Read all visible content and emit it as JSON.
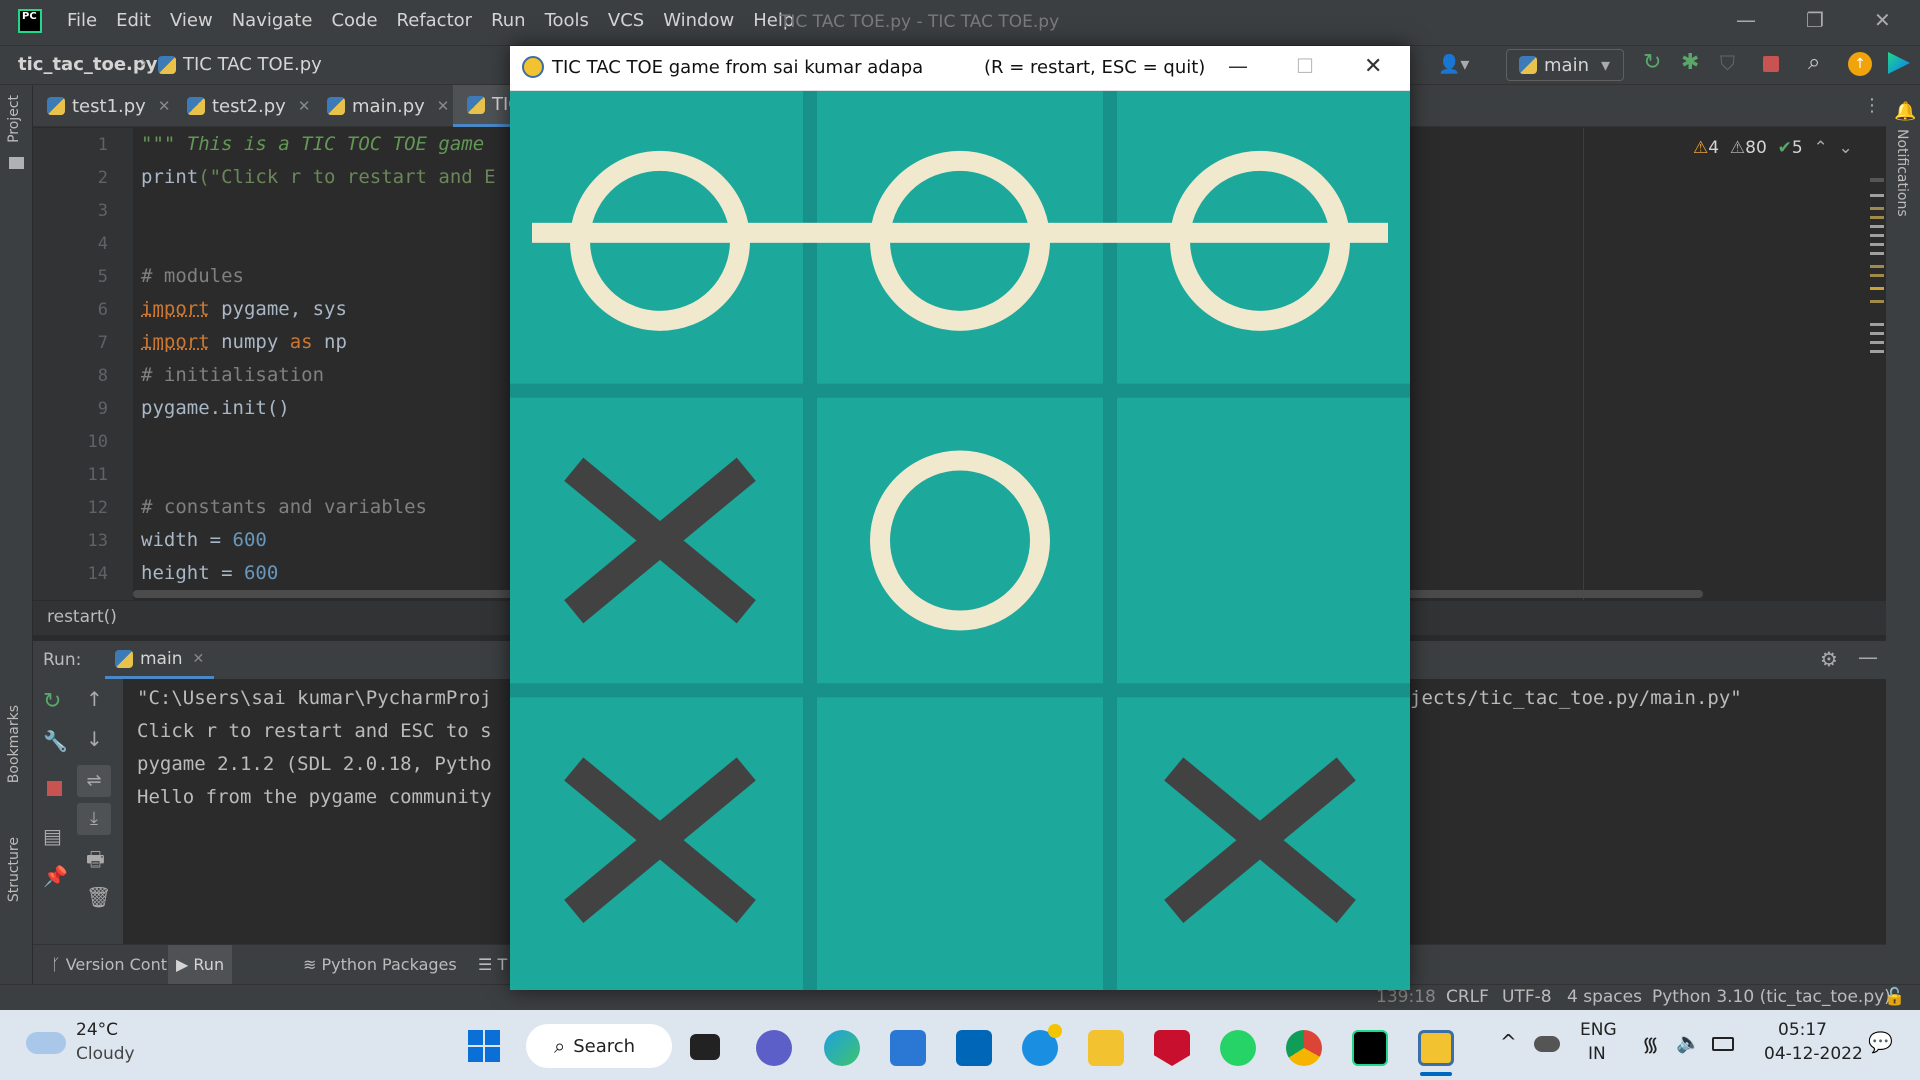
{
  "window": {
    "file_title": "TIC TAC TOE.py - TIC TAC TOE.py",
    "menu": [
      "File",
      "Edit",
      "View",
      "Navigate",
      "Code",
      "Refactor",
      "Run",
      "Tools",
      "VCS",
      "Window",
      "Help"
    ],
    "controls": {
      "minimize": "—",
      "restore": "❐",
      "close": "✕"
    }
  },
  "navbar": {
    "project": "tic_tac_toe.py",
    "file": "TIC TAC TOE.py",
    "run_config": "main"
  },
  "side": {
    "project_label": "Project",
    "bookmarks_label": "Bookmarks",
    "structure_label": "Structure",
    "notifications_label": "Notifications"
  },
  "tabs": [
    {
      "label": "test1.py"
    },
    {
      "label": "test2.py"
    },
    {
      "label": "main.py"
    },
    {
      "label": "TIC"
    }
  ],
  "inspections": {
    "warnings": "4",
    "weak_warnings": "80",
    "typos": "5"
  },
  "editor": {
    "line_numbers": [
      "1",
      "2",
      "3",
      "4",
      "5",
      "6",
      "7",
      "8",
      "9",
      "10",
      "11",
      "12",
      "13",
      "14"
    ],
    "line1": "\"\"\" This is a TIC TOC TOE game",
    "line2_fn": "print",
    "line2_str": "(\"Click r to restart and E",
    "line5": "# modules",
    "line6_kw": "import",
    "line6_rest": " pygame, sys",
    "line7_kw": "import",
    "line7_mid": " numpy ",
    "line7_as": "as",
    "line7_end": " np",
    "line8": "# initialisation",
    "line9": "pygame.init()",
    "line12": "# constants and variables",
    "line13_var": "width = ",
    "line13_num": "600",
    "line14_var": "height = ",
    "line14_num": "600"
  },
  "breadcrumb": "restart()",
  "run": {
    "label": "Run:",
    "tab": "main",
    "console": [
      "\"C:\\Users\\sai kumar\\PycharmProj",
      "Click r to restart and ESC to s",
      "pygame 2.1.2 (SDL 2.0.18, Pytho",
      "Hello from the pygame community"
    ],
    "console_path_tail": "jects/tic_tac_toe.py/main.py\""
  },
  "bottom_tools": [
    "Version Control",
    "Run",
    "Python Packages",
    "T"
  ],
  "status": {
    "position": "139:18",
    "line_sep": "CRLF",
    "encoding": "UTF-8",
    "indent": "4 spaces",
    "interpreter": "Python 3.10 (tic_tac_toe.py)"
  },
  "game": {
    "title": "TIC TAC TOE game from sai kumar adapa",
    "hint": "(R = restart, ESC = quit)",
    "board": [
      [
        "O",
        "O",
        "O"
      ],
      [
        "X",
        "O",
        ""
      ],
      [
        "X",
        "",
        "X"
      ]
    ],
    "winning_row": 0,
    "colors": {
      "bg": "#1ca99b",
      "line": "#17918a",
      "o": "#f1e9ce",
      "x": "#424242"
    }
  },
  "taskbar": {
    "weather_temp": "24°C",
    "weather_desc": "Cloudy",
    "search": "Search",
    "lang1": "ENG",
    "lang2": "IN",
    "time": "05:17",
    "date": "04-12-2022"
  }
}
